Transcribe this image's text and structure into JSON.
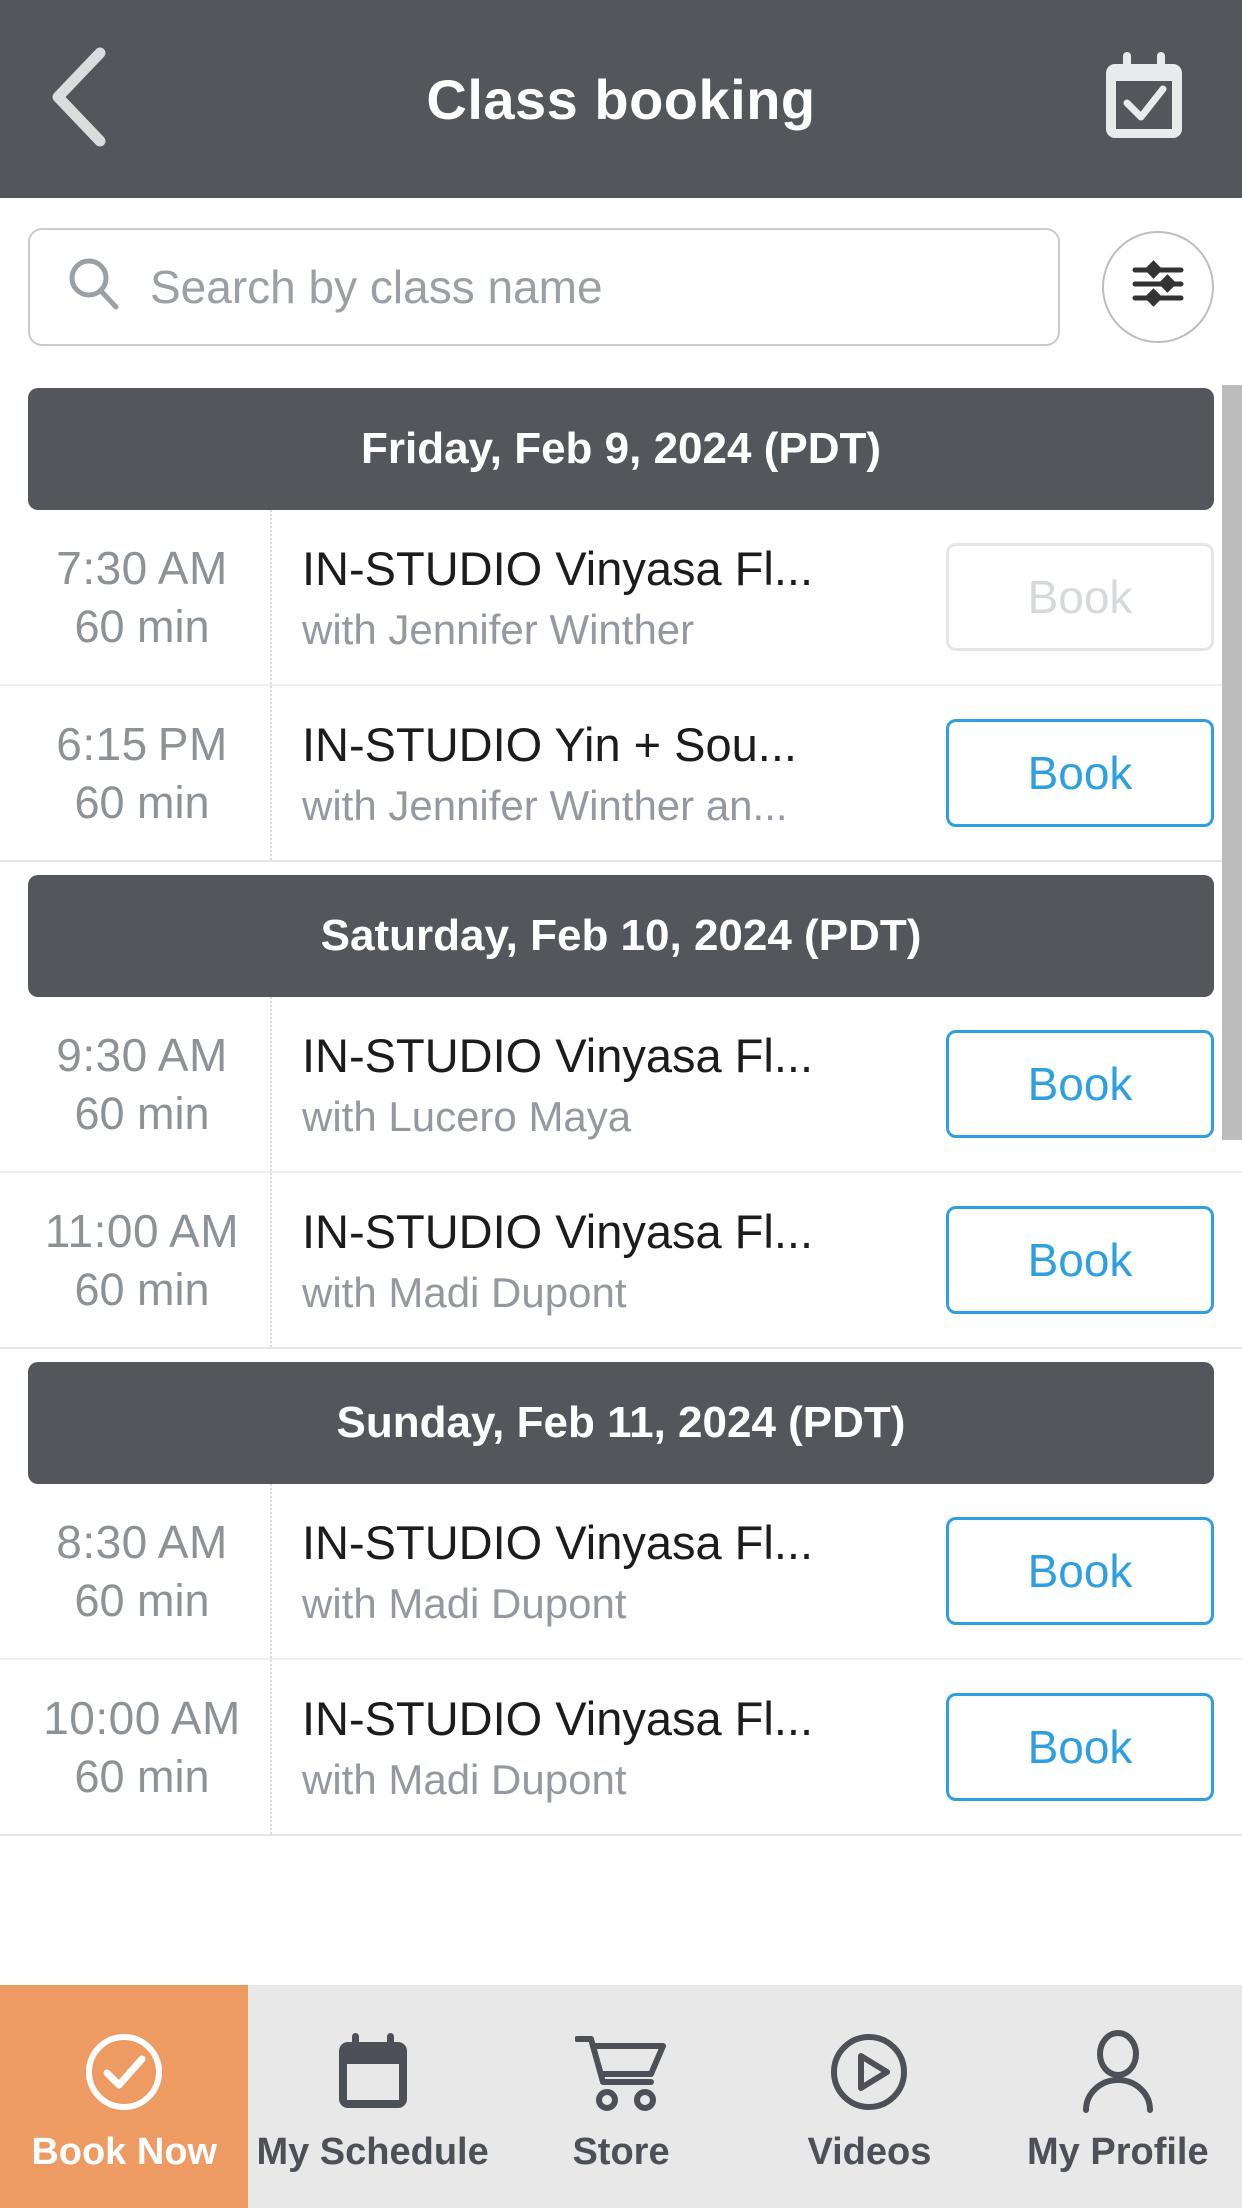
{
  "header": {
    "title": "Class booking",
    "back_icon": "chevron-left-icon",
    "calendar_icon": "calendar-check-icon"
  },
  "search": {
    "placeholder": "Search by class name",
    "value": "",
    "search_icon": "search-icon",
    "filter_icon": "filter-sliders-icon"
  },
  "colors": {
    "header_bg": "#53565b",
    "day_header_bg": "#53565b",
    "book_blue": "#2e9fe0",
    "book_disabled": "#d5d9dc",
    "active_tab_orange": "#ee9a63",
    "tabbar_bg": "#e8e8e8",
    "placeholder_gray": "#9aa0a6",
    "scrollbar": "#bcbcbc"
  },
  "days": [
    {
      "date_label": "Friday, Feb 9, 2024 (PDT)",
      "classes": [
        {
          "time": "7:30",
          "ampm": "AM",
          "duration": "60 min",
          "name": "IN-STUDIO Vinyasa Fl...",
          "teacher": "with Jennifer Winther",
          "book_label": "Book",
          "book_enabled": false
        },
        {
          "time": "6:15",
          "ampm": "PM",
          "duration": "60 min",
          "name": "IN-STUDIO Yin + Sou...",
          "teacher": "with Jennifer Winther an...",
          "book_label": "Book",
          "book_enabled": true
        }
      ]
    },
    {
      "date_label": "Saturday, Feb 10, 2024 (PDT)",
      "classes": [
        {
          "time": "9:30",
          "ampm": "AM",
          "duration": "60 min",
          "name": "IN-STUDIO Vinyasa Fl...",
          "teacher": "with Lucero Maya",
          "book_label": "Book",
          "book_enabled": true
        },
        {
          "time": "11:00",
          "ampm": "AM",
          "duration": "60 min",
          "name": "IN-STUDIO Vinyasa Fl...",
          "teacher": "with Madi Dupont",
          "book_label": "Book",
          "book_enabled": true
        }
      ]
    },
    {
      "date_label": "Sunday, Feb 11, 2024 (PDT)",
      "classes": [
        {
          "time": "8:30",
          "ampm": "AM",
          "duration": "60 min",
          "name": "IN-STUDIO Vinyasa Fl...",
          "teacher": "with Madi Dupont",
          "book_label": "Book",
          "book_enabled": true
        },
        {
          "time": "10:00",
          "ampm": "AM",
          "duration": "60 min",
          "name": "IN-STUDIO Vinyasa Fl...",
          "teacher": "with Madi Dupont",
          "book_label": "Book",
          "book_enabled": true
        }
      ]
    }
  ],
  "tabs": [
    {
      "label": "Book Now",
      "icon": "check-circle-icon",
      "active": true
    },
    {
      "label": "My Schedule",
      "icon": "calendar-icon",
      "active": false
    },
    {
      "label": "Store",
      "icon": "shopping-cart-icon",
      "active": false
    },
    {
      "label": "Videos",
      "icon": "play-circle-icon",
      "active": false
    },
    {
      "label": "My Profile",
      "icon": "person-icon",
      "active": false
    }
  ]
}
